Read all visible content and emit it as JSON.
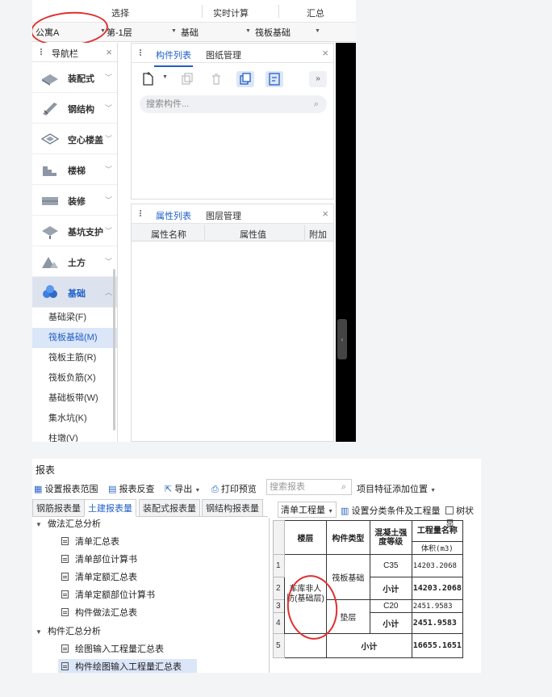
{
  "top": {
    "menu": {
      "select": "选择",
      "realtime": "实时计算",
      "summary": "汇总"
    },
    "selectors": {
      "building": "公寓A",
      "floor": "第-1层",
      "category": "基础",
      "component": "筏板基础"
    },
    "nav": {
      "title": "导航栏",
      "groups": [
        "装配式",
        "钢结构",
        "空心楼盖",
        "楼梯",
        "装修",
        "基坑支护",
        "土方",
        "基础"
      ],
      "sub_items": [
        "基础梁(F)",
        "筏板基础(M)",
        "筏板主筋(R)",
        "筏板负筋(X)",
        "基础板带(W)",
        "集水坑(K)",
        "柱墩(V)"
      ]
    },
    "component_panel": {
      "tab1": "构件列表",
      "tab2": "图纸管理",
      "search_placeholder": "搜索构件...",
      "more": "»"
    },
    "property_panel": {
      "tab1": "属性列表",
      "tab2": "图层管理",
      "col_name": "属性名称",
      "col_value": "属性值",
      "col_extra": "附加"
    }
  },
  "report": {
    "title": "报表",
    "toolbar": {
      "set_range": "设置报表范围",
      "review": "报表反查",
      "export": "导出",
      "print": "打印预览",
      "search_placeholder": "搜索报表",
      "feature_pos": "项目特征添加位置"
    },
    "tabs": [
      "钢筋报表量",
      "土建报表量",
      "装配式报表量",
      "钢结构报表量"
    ],
    "tree": {
      "group1": "做法汇总分析",
      "group1_items": [
        "清单汇总表",
        "清单部位计算书",
        "清单定额汇总表",
        "清单定额部位计算书",
        "构件做法汇总表"
      ],
      "group2": "构件汇总分析",
      "group2_items": [
        "绘图输入工程量汇总表",
        "构件绘图输入工程量汇总表"
      ]
    },
    "right_toolbar": {
      "qty_type": "清单工程量",
      "set_cond": "设置分类条件及工程量",
      "tree_label": "树状显"
    },
    "table": {
      "headers": {
        "floor": "楼层",
        "comp_type": "构件类型",
        "grade": "混凝土强度等级",
        "qty": "工程量名称",
        "volume": "体积(m3)"
      },
      "row_numbers": [
        "1",
        "2",
        "3",
        "4",
        "5"
      ],
      "floor_value": "车库非人防(基础层)",
      "rows": [
        {
          "type": "筏板基础",
          "grade": "C35",
          "volume": "14203.2068",
          "subtotal_label": "小计",
          "subtotal": "14203.2068"
        },
        {
          "type": "垫层",
          "grade": "C20",
          "volume": "2451.9583",
          "subtotal_label": "小计",
          "subtotal": "2451.9583"
        }
      ],
      "total_label": "小计",
      "total": "16655.1651"
    }
  }
}
